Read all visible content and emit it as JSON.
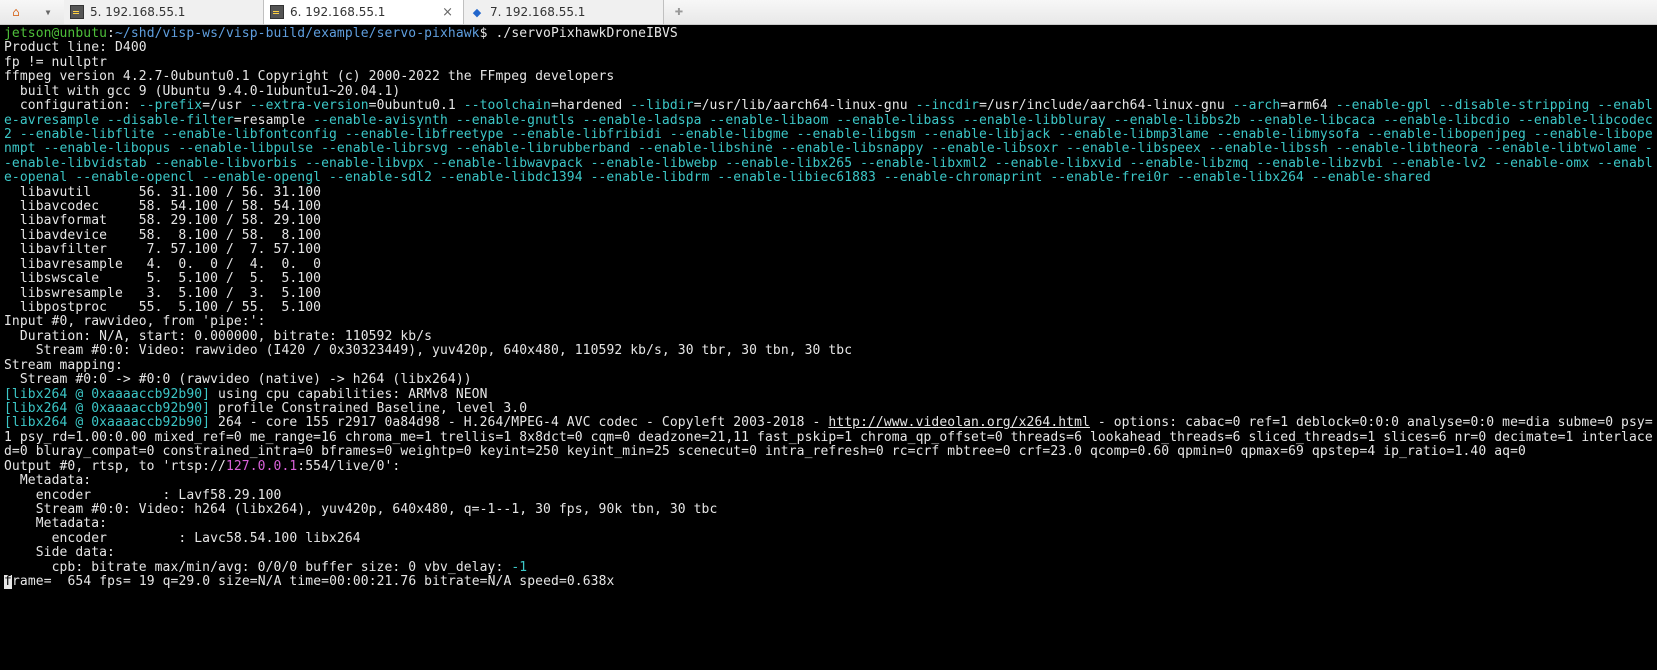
{
  "tabs": [
    {
      "title": "5. 192.168.55.1",
      "active": false,
      "iconType": "terminal"
    },
    {
      "title": "6. 192.168.55.1",
      "active": true,
      "iconType": "terminal"
    },
    {
      "title": "7. 192.168.55.1",
      "active": false,
      "iconType": "site"
    }
  ],
  "prompt": {
    "userhost": "jetson@unbutu",
    "sep1": ":",
    "path": "~/shd/visp-ws/visp-build/example/servo-pixhawk",
    "sep2": "$ ",
    "cmd": "./servoPixhawkDroneIBVS"
  },
  "pre_lines": [
    "Product line: D400",
    "fp != nullptr",
    "ffmpeg version 4.2.7-0ubuntu0.1 Copyright (c) 2000-2022 the FFmpeg developers",
    "  built with gcc 9 (Ubuntu 9.4.0-1ubuntu1~20.04.1)"
  ],
  "cfg": {
    "lead": "  configuration: ",
    "seg1": "--prefix",
    "eq1": "=/usr ",
    "seg2": "--extra-version",
    "eq2": "=0ubuntu0.1 ",
    "seg3": "--toolchain",
    "eq3": "=hardened ",
    "seg4": "--libdir",
    "eq4": "=/usr/lib/aarch64-linux-gnu ",
    "seg5": "--incdir",
    "eq5": "=/usr/include/aarch64-linux-gnu ",
    "seg6": "--arch",
    "eq6": "=arm64 ",
    "flags1": "--enable-gpl --disable-stripping --enable-avresample --disable-filter",
    "eq7": "=resample ",
    "flags2": "--enable-avisynth --enable-gnutls --enable-ladspa --enable-libaom --enable-libass --enable-libbluray --enable-libbs2b --enable-libcaca --enable-libcdio --enable-libcodec2 --enable-libflite --enable-libfontconfig --enable-libfreetype --enable-libfribidi --enable-libgme --enable-libgsm --enable-libjack --enable-libmp3lame --enable-libmysofa --enable-libopenjpeg --enable-libopenmpt --enable-libopus --enable-libpulse --enable-librsvg --enable-librubberband --enable-libshine --enable-libsnappy --enable-libsoxr --enable-libspeex --enable-libssh --enable-libtheora --enable-libtwolame --enable-libvidstab --enable-libvorbis --enable-libvpx --enable-libwavpack --enable-libwebp --enable-libx265 --enable-libxml2 --enable-libxvid --enable-libzmq --enable-libzvbi --enable-lv2 --enable-omx --enable-openal --enable-opencl --enable-opengl --enable-sdl2 --enable-libdc1394 --enable-libdrm --enable-libiec61883 --enable-chromaprint --enable-frei0r --enable-libx264 --enable-shared"
  },
  "lib_versions": [
    "  libavutil      56. 31.100 / 56. 31.100",
    "  libavcodec     58. 54.100 / 58. 54.100",
    "  libavformat    58. 29.100 / 58. 29.100",
    "  libavdevice    58.  8.100 / 58.  8.100",
    "  libavfilter     7. 57.100 /  7. 57.100",
    "  libavresample   4.  0.  0 /  4.  0.  0",
    "  libswscale      5.  5.100 /  5.  5.100",
    "  libswresample   3.  5.100 /  3.  5.100",
    "  libpostproc    55.  5.100 / 55.  5.100"
  ],
  "input_lines": [
    "Input #0, rawvideo, from 'pipe:':",
    "  Duration: N/A, start: 0.000000, bitrate: 110592 kb/s",
    "    Stream #0:0: Video: rawvideo (I420 / 0x30323449), yuv420p, 640x480, 110592 kb/s, 30 tbr, 30 tbn, 30 tbc",
    "Stream mapping:",
    "  Stream #0:0 -> #0:0 (rawvideo (native) -> h264 (libx264))"
  ],
  "libx264": {
    "tag": "[libx264 @ 0xaaaaccb92b90]",
    "l1": " using cpu capabilities: ARMv8 NEON",
    "l2": " profile Constrained Baseline, level 3.0",
    "l3a": " 264 - core 155 r2917 0a84d98 - H.264/MPEG-4 AVC codec - Copyleft 2003-2018 - ",
    "url": "http://www.videolan.org/x264.html",
    "l3b": " - options: cabac=0 ref=1 deblock=0:0:0 analyse=0:0 me=dia subme=0 psy=1 psy_rd=1.00:0.00 mixed_ref=0 me_range=16 chroma_me=1 trellis=1 8x8dct=0 cqm=0 deadzone=21,11 fast_pskip=1 chroma_qp_offset=0 threads=6 lookahead_threads=6 sliced_threads=1 slices=6 nr=0 decimate=1 interlaced=0 bluray_compat=0 constrained_intra=0 bframes=0 weightp=0 keyint=250 keyint_min=25 scenecut=0 intra_refresh=0 rc=crf mbtree=0 crf=23.0 qcomp=0.60 qpmin=0 qpmax=69 qpstep=4 ip_ratio=1.40 aq=0"
  },
  "output_head": {
    "pre": "Output #0, rtsp, to 'rtsp://",
    "ip": "127.0.0.1",
    "post": ":554/live/0':"
  },
  "output_meta": [
    "  Metadata:",
    "    encoder         : Lavf58.29.100",
    "    Stream #0:0: Video: h264 (libx264), yuv420p, 640x480, q=-1--1, 30 fps, 90k tbn, 30 tbc",
    "    Metadata:",
    "      encoder         : Lavc58.54.100 libx264",
    "    Side data:"
  ],
  "cpb": {
    "pre": "      cpb: bitrate max/min/avg: 0/0/0 buffer size: 0 vbv_delay: ",
    "val": "-1"
  },
  "frame": {
    "cursor_char": "f",
    "rest": "rame=  654 fps= 19 q=29.0 size=N/A time=00:00:21.76 bitrate=N/A speed=0.638x"
  }
}
